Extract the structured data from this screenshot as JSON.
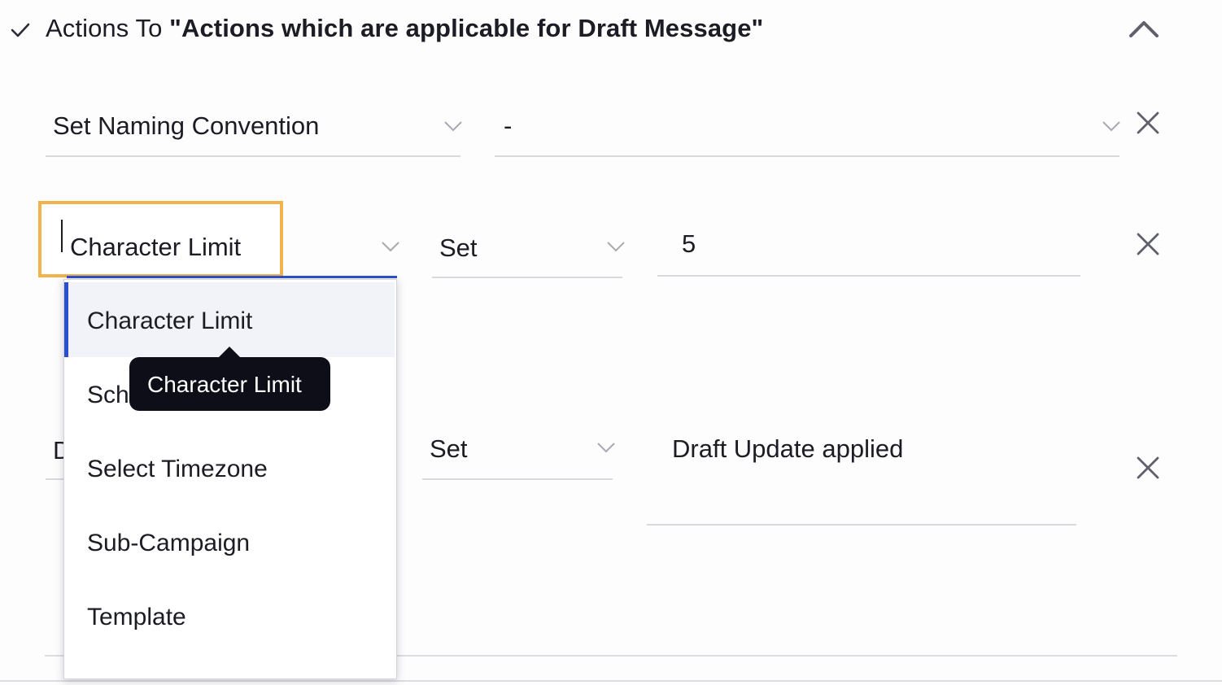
{
  "header": {
    "prefix": "Actions To ",
    "title": "\"Actions which are applicable for Draft Message\"",
    "icons": {
      "left": "check-icon",
      "right": "chevron-up-icon"
    }
  },
  "rows": [
    {
      "field": "Set Naming Convention",
      "value": "-"
    },
    {
      "field": "Character Limit",
      "operator": "Set",
      "value": "5"
    },
    {
      "field_partial": "D",
      "operator": "Set",
      "value": "Draft Update applied"
    }
  ],
  "dropdown": {
    "items": [
      {
        "label": "Character Limit",
        "active": true
      },
      {
        "label": "Sch"
      },
      {
        "label": "Select Timezone"
      },
      {
        "label": "Sub-Campaign"
      },
      {
        "label": "Template"
      }
    ]
  },
  "tooltip": {
    "label": "Character Limit"
  },
  "colors": {
    "highlight": "#f2b24c",
    "accent": "#2a4fcf",
    "tooltip_bg": "#0d0e18",
    "active_item_bg": "#f2f3f9"
  }
}
